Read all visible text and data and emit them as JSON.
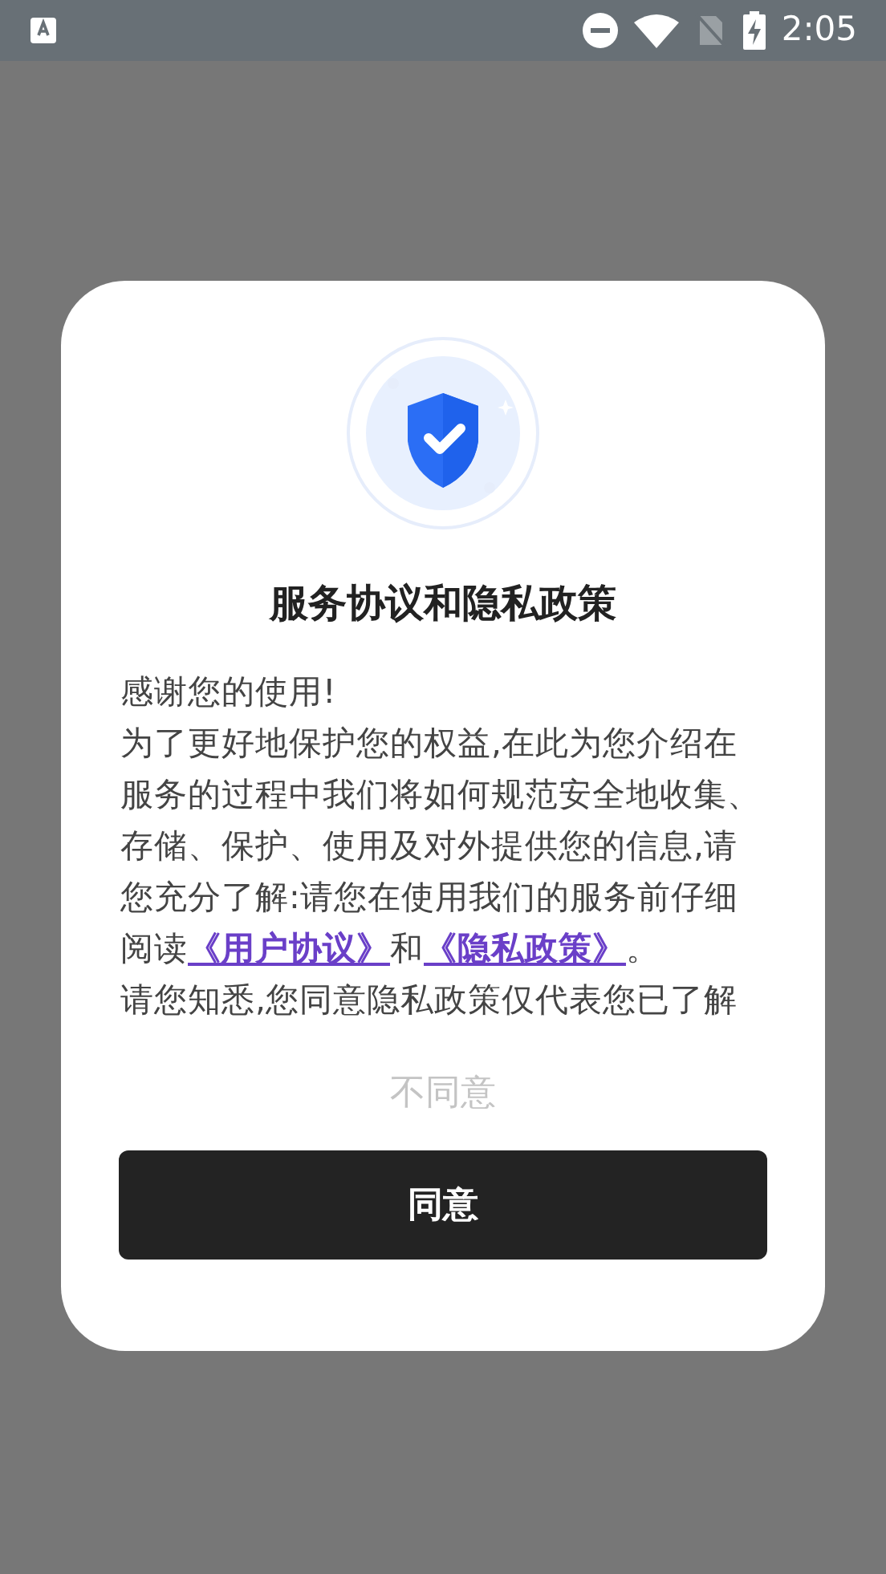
{
  "status_bar": {
    "time": "2:05"
  },
  "dialog": {
    "title": "服务协议和隐私政策",
    "paragraphs": [
      {
        "parts": [
          {
            "kind": "text",
            "text": "感谢您的使用!"
          }
        ]
      },
      {
        "parts": [
          {
            "kind": "text",
            "text": "为了更好地保护您的权益,在此为您介绍在服务的过程中我们将如何规范安全地收集、存储、保护、使用及对外提供您的信息,请您充分了解:请您在使用我们的服务前仔细阅读"
          },
          {
            "kind": "link",
            "text": "《用户协议》"
          },
          {
            "kind": "text",
            "text": "和"
          },
          {
            "kind": "link",
            "text": "《隐私政策》"
          },
          {
            "kind": "text",
            "text": "。"
          }
        ]
      },
      {
        "parts": [
          {
            "kind": "text",
            "text": "请您知悉,您同意隐私政策仅代表您已了解"
          }
        ]
      }
    ],
    "decline_button": "不同意",
    "accept_button": "同意"
  }
}
